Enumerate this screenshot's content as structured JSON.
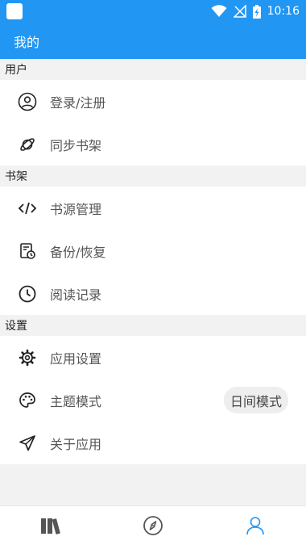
{
  "status_bar": {
    "time": "10:16",
    "icons": [
      "app-icon",
      "wifi-icon",
      "no-signal-icon",
      "battery-charging-icon"
    ]
  },
  "app_bar": {
    "title": "我的"
  },
  "sections": {
    "user": {
      "header": "用户",
      "items": [
        {
          "label": "登录/注册",
          "icon": "account-circle-icon"
        },
        {
          "label": "同步书架",
          "icon": "planet-sync-icon"
        }
      ]
    },
    "bookshelf": {
      "header": "书架",
      "items": [
        {
          "label": "书源管理",
          "icon": "code-icon"
        },
        {
          "label": "备份/恢复",
          "icon": "backup-restore-icon"
        },
        {
          "label": "阅读记录",
          "icon": "clock-icon"
        }
      ]
    },
    "settings": {
      "header": "设置",
      "items": [
        {
          "label": "应用设置",
          "icon": "gear-icon"
        },
        {
          "label": "主题模式",
          "icon": "palette-icon",
          "value": "日间模式"
        },
        {
          "label": "关于应用",
          "icon": "paper-plane-icon"
        }
      ]
    }
  },
  "bottom_nav": {
    "items": [
      {
        "icon": "bookshelf-icon",
        "active": false
      },
      {
        "icon": "compass-icon",
        "active": false
      },
      {
        "icon": "person-icon",
        "active": true
      }
    ],
    "active_color": "#2196f3",
    "inactive_color": "#555555"
  },
  "colors": {
    "primary": "#2196f3",
    "background": "#f2f2f2"
  }
}
